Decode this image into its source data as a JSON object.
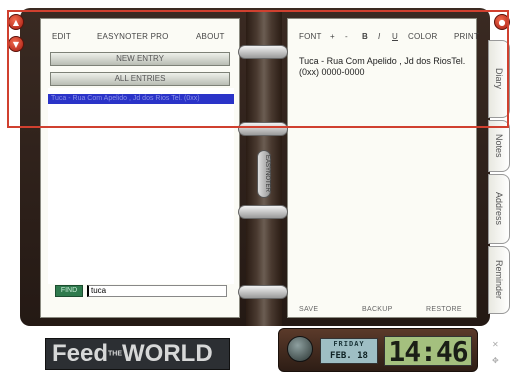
{
  "left_menu": {
    "edit": "EDIT",
    "app_name": "EASYNOTER PRO",
    "about": "ABOUT"
  },
  "left_buttons": {
    "new_entry": "NEW ENTRY",
    "all_entries": "ALL ENTRIES"
  },
  "entry_list": [
    {
      "text": "Tuca - Rua Com Apelido , Jd dos Rios Tel. (0xx)"
    }
  ],
  "find": {
    "button": "FIND",
    "value": "tuca"
  },
  "right_menu": {
    "font": "FONT",
    "plus": "+",
    "minus": "-",
    "bold": "B",
    "italic": "I",
    "underline": "U",
    "color": "COLOR",
    "print": "PRINT"
  },
  "entry_text": "Tuca - Rua Com Apelido , Jd dos RiosTel. (0xx) 0000-0000",
  "right_bottom": {
    "save": "SAVE",
    "backup": "BACKUP",
    "restore": "RESTORE"
  },
  "tabs": {
    "diary": "Diary",
    "notes": "Notes",
    "address": "Address",
    "reminder": "Reminder"
  },
  "spine_label": "EASYNOTER",
  "round_buttons": {
    "up": "▲",
    "down": "▼",
    "close": "●"
  },
  "feed_banner": {
    "part1": "Feed",
    "part2": "THE",
    "part3": "WORLD"
  },
  "clock": {
    "day": "FRIDAY",
    "date": "FEB. 18",
    "time": "14:46"
  },
  "colors": {
    "accent_red": "#d0402f",
    "selection_blue": "#2a33c8",
    "find_green": "#2f7a4d",
    "lcd_green": "#a4c07e"
  }
}
